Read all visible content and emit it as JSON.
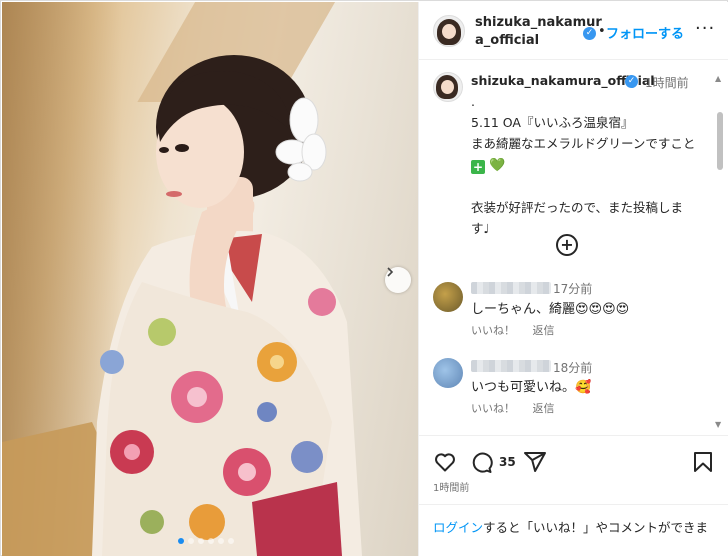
{
  "post": {
    "username_line1": "shizuka_nakamur",
    "username_line2": "a_official",
    "separator": "•",
    "follow_label": "フォローする",
    "more_label": "···"
  },
  "caption": {
    "username": "shizuka_nakamura_official",
    "time": "1時間前",
    "text": ".\n5.11 OA『いいふろ温泉宿』\nまあ綺麗なエメラルドグリーンですこと",
    "text_line2": "衣装が好評だったので、また投稿しま\nす♩",
    "emoji_plus": "+",
    "emoji_heart": "💚"
  },
  "comments": [
    {
      "time": "17分前",
      "text": "しーちゃん、綺麗😍😍😍😍",
      "like": "いいね！",
      "reply": "返信"
    },
    {
      "time": "18分前",
      "text": "いつも可愛いね。🥰",
      "like": "いいね！",
      "reply": "返信"
    }
  ],
  "actions": {
    "comment_count": "35",
    "posted_time": "1時間前"
  },
  "login": {
    "link": "ログイン",
    "text": "すると「いいね！」やコメントができま"
  },
  "carousel": {
    "current": 1,
    "total": 6
  },
  "colors": {
    "accent": "#0095f6",
    "verified": "#3897f0"
  },
  "icons": [
    "chevron-right-icon",
    "plus-circle-icon",
    "heart-icon",
    "comment-icon",
    "share-icon",
    "bookmark-icon",
    "verified-badge-icon"
  ]
}
